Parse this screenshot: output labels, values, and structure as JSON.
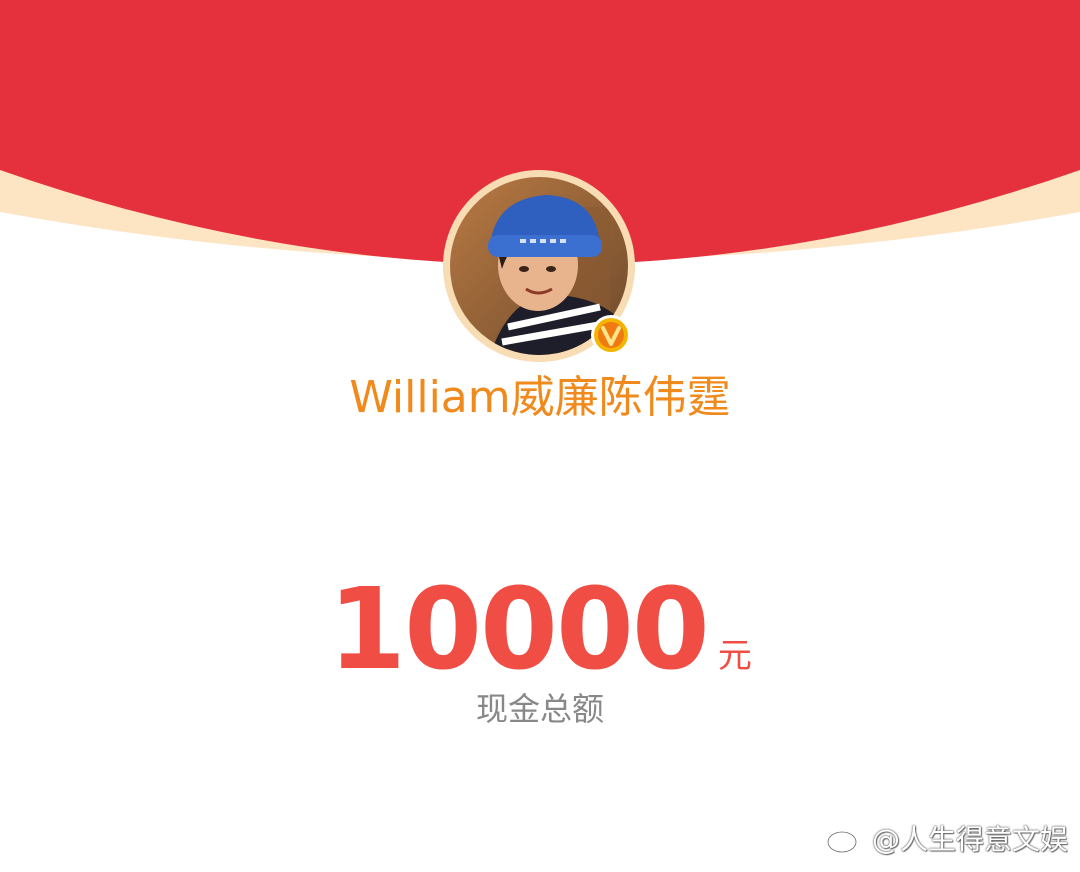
{
  "sender": {
    "name": "William威廉陈伟霆",
    "verified": true
  },
  "amount": {
    "value": "10000",
    "unit": "元",
    "caption": "现金总额"
  },
  "watermark": {
    "text": "@人生得意文娱",
    "icon": "weibo-logo-icon"
  },
  "colors": {
    "header_red": "#e5303e",
    "header_rim": "#fde4c3",
    "name_orange": "#f08a1c",
    "amount_red": "#f04e45",
    "caption_gray": "#888888"
  }
}
